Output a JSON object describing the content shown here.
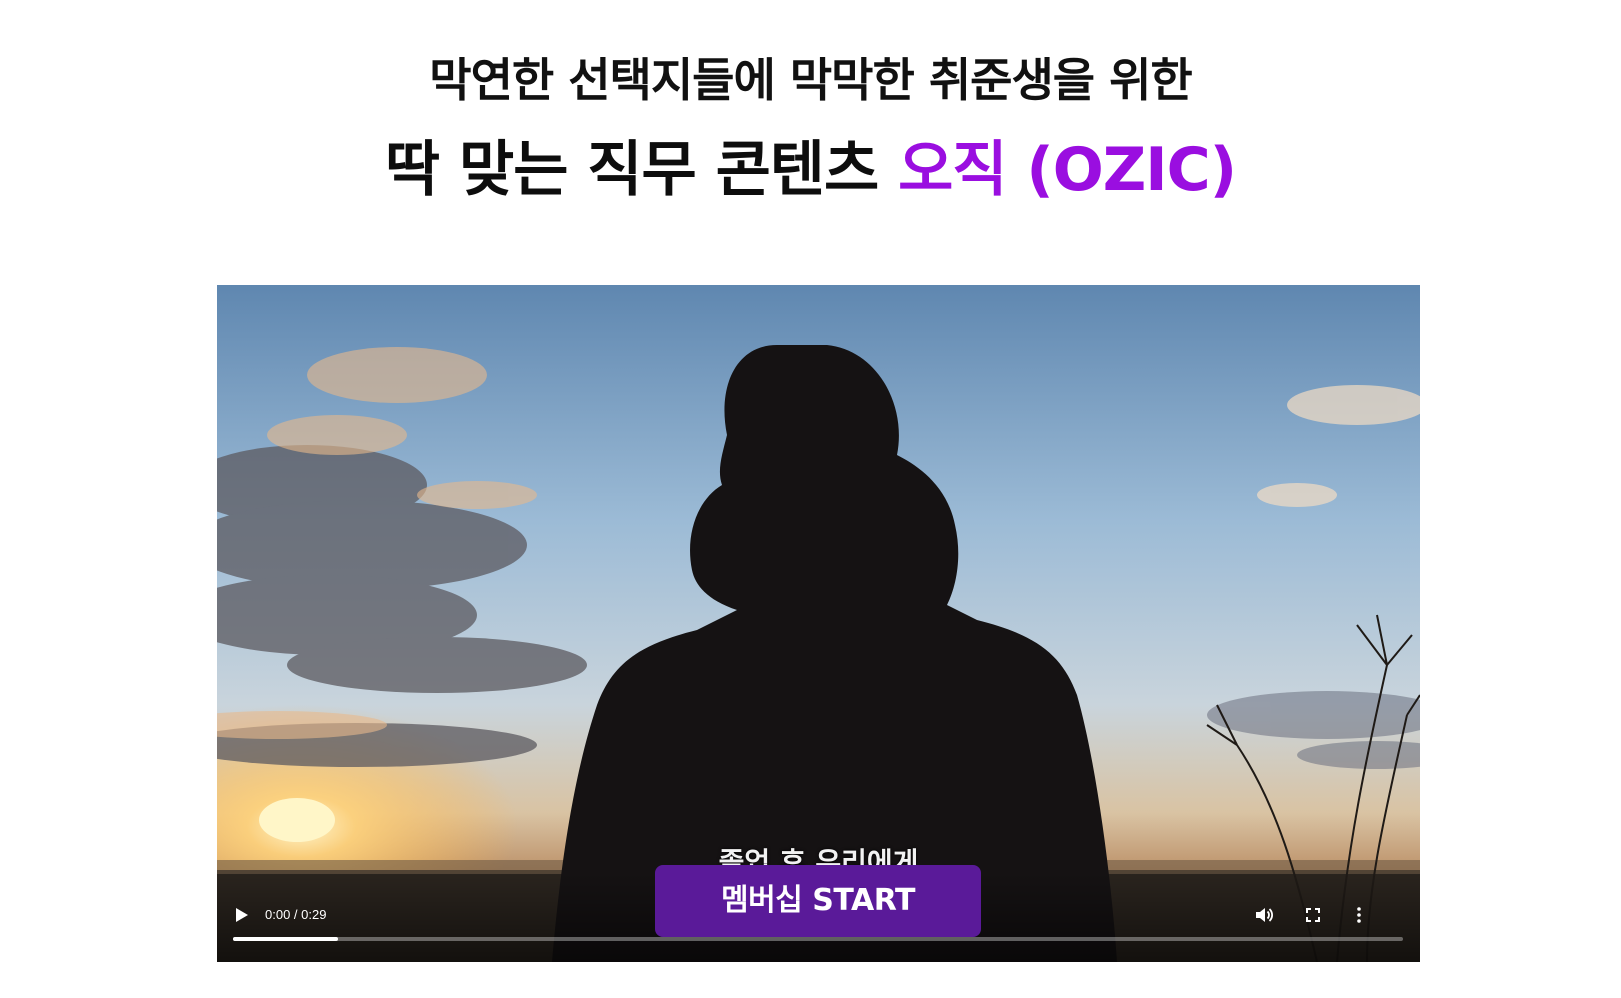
{
  "headline": {
    "line1": "막연한 선택지들에 막막한 취준생을 위한",
    "line2_prefix": "딱 맞는 직무 콘텐츠 ",
    "line2_brand": "오직 (OZIC)"
  },
  "video": {
    "subtitle": "졸업 후 우리에게",
    "time": "0:00 / 0:29",
    "progress": 0.09,
    "icons": [
      "play-icon",
      "volume-icon",
      "fullscreen-icon",
      "more-options-icon"
    ]
  },
  "cta": {
    "label": "멤버십 START"
  },
  "colors": {
    "brand": "#9a0ee0",
    "cta_background": "#5a1a99",
    "headline": "#111111"
  }
}
